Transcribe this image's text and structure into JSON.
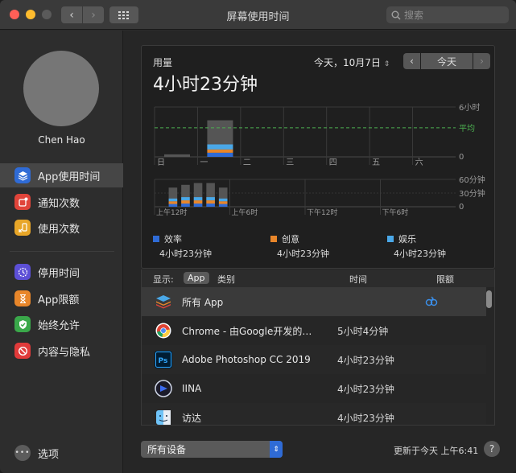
{
  "window": {
    "title": "屏幕使用时间"
  },
  "search": {
    "placeholder": "搜索"
  },
  "sidebar": {
    "user": "Chen Hao",
    "items": [
      {
        "label": "App使用时间",
        "icon": "layers-icon",
        "color": "#2f6bd6"
      },
      {
        "label": "通知次数",
        "icon": "notification-icon",
        "color": "#e0443a"
      },
      {
        "label": "使用次数",
        "icon": "pickups-icon",
        "color": "#e8a628"
      },
      {
        "label": "停用时间",
        "icon": "downtime-icon",
        "color": "#5c4fd6"
      },
      {
        "label": "App限额",
        "icon": "hourglass-icon",
        "color": "#e8862a"
      },
      {
        "label": "始终允许",
        "icon": "checkmark-icon",
        "color": "#3aa84a"
      },
      {
        "label": "内容与隐私",
        "icon": "restriction-icon",
        "color": "#e03a3a"
      }
    ],
    "options": "选项"
  },
  "summary": {
    "usage_label": "用量",
    "usage_value": "4小时23分钟",
    "date": "今天，10月7日",
    "today_button": "今天"
  },
  "chart_data": [
    {
      "type": "bar",
      "title": "",
      "categories": [
        "日",
        "一",
        "二",
        "三",
        "四",
        "五",
        "六"
      ],
      "y_ticks": [
        "6小时",
        "0"
      ],
      "ylim": [
        0,
        6
      ],
      "average_label": "平均",
      "average": 3.5,
      "series": [
        {
          "name": "效率",
          "values": [
            0,
            0.5,
            0,
            0,
            0,
            0,
            0
          ]
        },
        {
          "name": "创意",
          "values": [
            0,
            0.4,
            0,
            0,
            0,
            0,
            0
          ]
        },
        {
          "name": "娱乐",
          "values": [
            0,
            0.6,
            0,
            0,
            0,
            0,
            0
          ]
        }
      ],
      "totals": [
        0.3,
        4.4,
        0,
        0,
        0,
        0,
        0
      ]
    },
    {
      "type": "bar",
      "title": "",
      "x_ticks": [
        "上午12时",
        "上午6时",
        "下午12时",
        "下午6时"
      ],
      "y_ticks": [
        "60分钟",
        "30分钟",
        "0"
      ],
      "ylim": [
        0,
        60
      ],
      "hours": [
        1,
        2,
        3,
        4,
        5
      ],
      "series": [
        {
          "name": "效率",
          "values": [
            6,
            7,
            7,
            7,
            6
          ]
        },
        {
          "name": "创意",
          "values": [
            6,
            7,
            7,
            7,
            6
          ]
        },
        {
          "name": "娱乐",
          "values": [
            6,
            7,
            7,
            7,
            6
          ]
        }
      ],
      "totals": [
        42,
        48,
        52,
        52,
        42
      ]
    }
  ],
  "legend": [
    {
      "name": "效率",
      "value": "4小时23分钟",
      "color": "#2f6bd6"
    },
    {
      "name": "创意",
      "value": "4小时23分钟",
      "color": "#e8862a"
    },
    {
      "name": "娱乐",
      "value": "4小时23分钟",
      "color": "#4aa8e8"
    }
  ],
  "table": {
    "show_label": "显示:",
    "tab_app": "App",
    "tab_category": "类别",
    "col_time": "时间",
    "col_limit": "限额",
    "rows": [
      {
        "name": "所有 App",
        "time": "",
        "icon": "all-apps-icon"
      },
      {
        "name": "Chrome - 由Google开发的…",
        "time": "5小时4分钟",
        "icon": "chrome-icon"
      },
      {
        "name": "Adobe Photoshop CC 2019",
        "time": "4小时23分钟",
        "icon": "photoshop-icon"
      },
      {
        "name": "IINA",
        "time": "4小时23分钟",
        "icon": "iina-icon"
      },
      {
        "name": "访达",
        "time": "4小时23分钟",
        "icon": "finder-icon"
      }
    ]
  },
  "footer": {
    "device": "所有设备",
    "updated": "更新于今天 上午6:41"
  }
}
